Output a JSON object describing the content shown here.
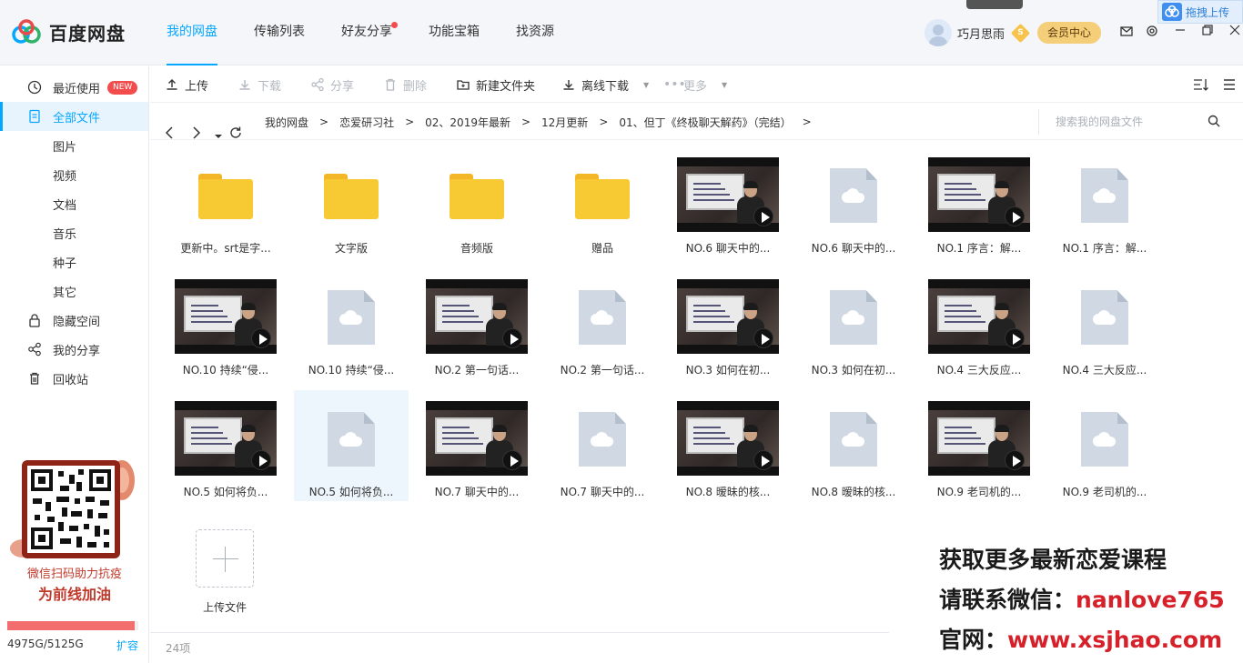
{
  "app": {
    "name": "百度网盘"
  },
  "nav": {
    "items": [
      {
        "label": "我的网盘",
        "active": true
      },
      {
        "label": "传输列表"
      },
      {
        "label": "好友分享",
        "dot": true
      },
      {
        "label": "功能宝箱"
      },
      {
        "label": "找资源"
      }
    ]
  },
  "user": {
    "name": "巧月思雨",
    "coin": "S",
    "vip_label": "会员中心"
  },
  "drag_upload": "拖拽上传",
  "sidebar": {
    "items": [
      {
        "label": "最近使用",
        "badge": "NEW",
        "icon": "clock-icon"
      },
      {
        "label": "全部文件",
        "icon": "file-icon",
        "active": true
      },
      {
        "label": "图片"
      },
      {
        "label": "视频"
      },
      {
        "label": "文档"
      },
      {
        "label": "音乐"
      },
      {
        "label": "种子"
      },
      {
        "label": "其它"
      },
      {
        "label": "隐藏空间",
        "icon": "lock-icon"
      },
      {
        "label": "我的分享",
        "icon": "share-icon"
      },
      {
        "label": "回收站",
        "icon": "trash-icon"
      }
    ],
    "promo": {
      "line1": "微信扫码助力抗疫",
      "line2": "为前线加油"
    },
    "quota": {
      "text": "4975G/5125G",
      "expand": "扩容",
      "used_fraction": 0.971
    }
  },
  "toolbar": {
    "upload": "上传",
    "download": "下载",
    "share": "分享",
    "delete": "删除",
    "new_folder": "新建文件夹",
    "offline": "离线下载",
    "more": "更多"
  },
  "path": {
    "crumbs": [
      "我的网盘",
      "恋爱研习社",
      "02、2019年最新",
      "12月更新",
      "01、但丁《终极聊天解药》（完结）"
    ],
    "search_placeholder": "搜索我的网盘文件"
  },
  "files": [
    {
      "name": "更新中。srt是字...",
      "type": "folder"
    },
    {
      "name": "文字版",
      "type": "folder"
    },
    {
      "name": "音频版",
      "type": "folder"
    },
    {
      "name": "赠品",
      "type": "folder"
    },
    {
      "name": "NO.6 聊天中的...",
      "type": "video"
    },
    {
      "name": "NO.6 聊天中的...",
      "type": "doc"
    },
    {
      "name": "NO.1 序言：解...",
      "type": "video"
    },
    {
      "name": "NO.1 序言：解...",
      "type": "doc"
    },
    {
      "name": "NO.10 持续“侵...",
      "type": "video"
    },
    {
      "name": "NO.10 持续“侵...",
      "type": "doc"
    },
    {
      "name": "NO.2 第一句话...",
      "type": "video"
    },
    {
      "name": "NO.2 第一句话...",
      "type": "doc"
    },
    {
      "name": "NO.3 如何在初...",
      "type": "video"
    },
    {
      "name": "NO.3 如何在初...",
      "type": "doc"
    },
    {
      "name": "NO.4 三大反应...",
      "type": "video"
    },
    {
      "name": "NO.4 三大反应...",
      "type": "doc"
    },
    {
      "name": "NO.5 如何将负...",
      "type": "video"
    },
    {
      "name": "NO.5 如何将负...",
      "type": "doc",
      "selected": true
    },
    {
      "name": "NO.7 聊天中的...",
      "type": "video"
    },
    {
      "name": "NO.7 聊天中的...",
      "type": "doc"
    },
    {
      "name": "NO.8 暧昧的核...",
      "type": "video"
    },
    {
      "name": "NO.8 暧昧的核...",
      "type": "doc"
    },
    {
      "name": "NO.9 老司机的...",
      "type": "video"
    },
    {
      "name": "NO.9 老司机的...",
      "type": "doc"
    }
  ],
  "upload_tile": "上传文件",
  "status": {
    "count": "24项"
  },
  "overlay": {
    "line1": "获取更多最新恋爱课程",
    "line2_prefix": "请联系微信：",
    "line2_value": "nanlove765",
    "line3_prefix": "官网：",
    "line3_value": "www.xsjhao.com"
  },
  "colors": {
    "accent": "#06a7ff",
    "folder": "#f7c932",
    "new_badge": "#f24c4c",
    "ad_red": "#d6202a"
  }
}
